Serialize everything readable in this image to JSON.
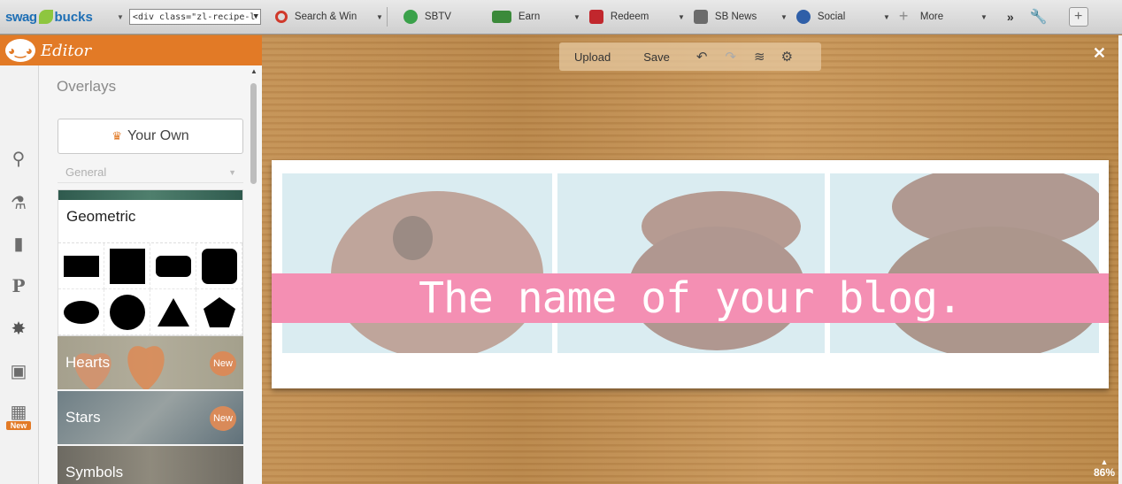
{
  "toolbar": {
    "brand_swag": "swag",
    "brand_bucks": "bucks",
    "select_value": "<div class=\"zl-recipe-l",
    "items": [
      {
        "label": "Search & Win",
        "icon": "search-icon",
        "color": "#d0392b"
      },
      {
        "label": "SBTV",
        "icon": "play-icon",
        "color": "#3aa14a"
      },
      {
        "label": "Earn",
        "icon": "money-icon",
        "color": "#3b8a3a"
      },
      {
        "label": "Redeem",
        "icon": "gift-icon",
        "color": "#c1272d"
      },
      {
        "label": "SB News",
        "icon": "chat-icon",
        "color": "#6b6b6b"
      },
      {
        "label": "Social",
        "icon": "people-icon",
        "color": "#2f5fa8"
      },
      {
        "label": "More",
        "icon": "plus-icon",
        "color": "#8a8a8a"
      }
    ],
    "overflow": "»"
  },
  "editor": {
    "title": "Editor",
    "panel_title": "Overlays",
    "your_own_label": "Your Own",
    "category_select": "General",
    "geometric_title": "Geometric",
    "overlays": [
      {
        "name": "Hearts",
        "badge": "New"
      },
      {
        "name": "Stars",
        "badge": "New"
      },
      {
        "name": "Symbols",
        "badge": ""
      }
    ],
    "rail_new_badge": "New"
  },
  "canvas": {
    "upload_label": "Upload",
    "save_label": "Save",
    "banner_text": "The name of your blog.",
    "zoom_level": "86%",
    "accent_color": "#f48fb3"
  }
}
